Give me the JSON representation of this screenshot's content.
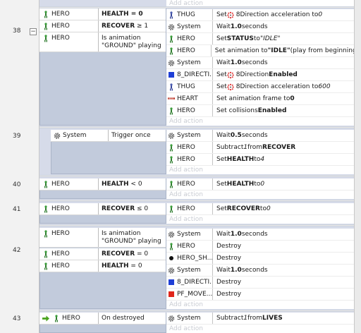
{
  "add_action_label": "Add action",
  "events": [
    {
      "number": "38",
      "collapse": "−",
      "conditions": [
        {
          "object": "HERO",
          "icon": "hero-icon",
          "parts": [
            {
              "t": "HEALTH = 0",
              "b": true
            }
          ]
        },
        {
          "object": "HERO",
          "icon": "hero-icon",
          "parts": [
            {
              "t": "RECOVER",
              "b": true
            },
            {
              "t": " ≥ 1"
            }
          ]
        },
        {
          "object": "HERO",
          "icon": "hero-icon",
          "parts": [
            {
              "t": "Is animation"
            },
            {
              "br": true
            },
            {
              "t": "\"GROUND\" playing"
            }
          ]
        }
      ],
      "actions": [
        {
          "object": "THUG",
          "icon": "thug-icon",
          "parts": [
            {
              "t": "Set "
            },
            {
              "icon": "8direction-icon"
            },
            {
              "t": "8Direction acceleration to "
            },
            {
              "t": "0",
              "i": true
            }
          ]
        },
        {
          "object": "System",
          "icon": "gear-icon",
          "parts": [
            {
              "t": "Wait "
            },
            {
              "t": "1.0",
              "b": true
            },
            {
              "t": " seconds"
            }
          ]
        },
        {
          "object": "HERO",
          "icon": "hero-icon",
          "parts": [
            {
              "t": "Set "
            },
            {
              "t": "STATUS",
              "b": true
            },
            {
              "t": " to "
            },
            {
              "t": "\"IDLE\"",
              "i": true
            }
          ]
        },
        {
          "object": "HERO",
          "icon": "hero-icon",
          "parts": [
            {
              "t": "Set animation to "
            },
            {
              "t": "\"IDLE\"",
              "b": true
            },
            {
              "t": " (play from beginning)"
            }
          ]
        },
        {
          "object": "System",
          "icon": "gear-icon",
          "parts": [
            {
              "t": "Wait "
            },
            {
              "t": "1.0",
              "b": true
            },
            {
              "t": " seconds"
            }
          ]
        },
        {
          "object": "8_DIRECTI...",
          "icon": "blue-square-icon",
          "parts": [
            {
              "t": "Set "
            },
            {
              "icon": "8direction-icon"
            },
            {
              "t": "8Direction "
            },
            {
              "t": "Enabled",
              "b": true
            }
          ]
        },
        {
          "object": "THUG",
          "icon": "thug-icon",
          "parts": [
            {
              "t": "Set "
            },
            {
              "icon": "8direction-icon"
            },
            {
              "t": "8Direction acceleration to "
            },
            {
              "t": "600",
              "i": true
            }
          ]
        },
        {
          "object": "HEART",
          "icon": "heart-strip-icon",
          "parts": [
            {
              "t": "Set animation frame to "
            },
            {
              "t": "0",
              "b": true
            }
          ]
        },
        {
          "object": "HERO",
          "icon": "hero-icon",
          "parts": [
            {
              "t": "Set collisions "
            },
            {
              "t": "Enabled",
              "b": true
            }
          ]
        }
      ]
    },
    {
      "number": "39",
      "conditions": [
        {
          "object": "System",
          "icon": "gear-icon",
          "parts": [
            {
              "t": "Trigger once"
            }
          ]
        }
      ],
      "actions": [
        {
          "object": "System",
          "icon": "gear-icon",
          "parts": [
            {
              "t": "Wait "
            },
            {
              "t": "0.5",
              "b": true
            },
            {
              "t": " seconds"
            }
          ]
        },
        {
          "object": "HERO",
          "icon": "hero-icon",
          "parts": [
            {
              "t": "Subtract "
            },
            {
              "t": "1",
              "i": true
            },
            {
              "t": " from "
            },
            {
              "t": "RECOVER",
              "b": true
            }
          ]
        },
        {
          "object": "HERO",
          "icon": "hero-icon",
          "parts": [
            {
              "t": "Set "
            },
            {
              "t": "HEALTH",
              "b": true
            },
            {
              "t": " to "
            },
            {
              "t": "4",
              "i": true
            }
          ]
        }
      ]
    },
    {
      "number": "40",
      "conditions": [
        {
          "object": "HERO",
          "icon": "hero-icon",
          "parts": [
            {
              "t": "HEALTH",
              "b": true
            },
            {
              "t": " < 0"
            }
          ]
        }
      ],
      "actions": [
        {
          "object": "HERO",
          "icon": "hero-icon",
          "parts": [
            {
              "t": "Set "
            },
            {
              "t": "HEALTH",
              "b": true
            },
            {
              "t": " to "
            },
            {
              "t": "0",
              "i": true
            }
          ]
        }
      ]
    },
    {
      "number": "41",
      "conditions": [
        {
          "object": "HERO",
          "icon": "hero-icon",
          "parts": [
            {
              "t": "RECOVER",
              "b": true
            },
            {
              "t": " ≤ 0"
            }
          ]
        }
      ],
      "actions": [
        {
          "object": "HERO",
          "icon": "hero-icon",
          "parts": [
            {
              "t": "Set "
            },
            {
              "t": "RECOVER",
              "b": true
            },
            {
              "t": " to "
            },
            {
              "t": "0",
              "i": true
            }
          ]
        }
      ]
    },
    {
      "number": "42",
      "conditions": [
        {
          "object": "HERO",
          "icon": "hero-icon",
          "parts": [
            {
              "t": "Is animation"
            },
            {
              "br": true
            },
            {
              "t": "\"GROUND\" playing"
            }
          ]
        },
        {
          "object": "HERO",
          "icon": "hero-icon",
          "parts": [
            {
              "t": "RECOVER",
              "b": true
            },
            {
              "t": " = 0"
            }
          ]
        },
        {
          "object": "HERO",
          "icon": "hero-icon",
          "parts": [
            {
              "t": "HEALTH",
              "b": true
            },
            {
              "t": " = 0"
            }
          ]
        }
      ],
      "actions": [
        {
          "object": "System",
          "icon": "gear-icon",
          "parts": [
            {
              "t": "Wait "
            },
            {
              "t": "1.0",
              "b": true
            },
            {
              "t": " seconds"
            }
          ]
        },
        {
          "object": "HERO",
          "icon": "hero-icon",
          "parts": [
            {
              "t": "Destroy"
            }
          ]
        },
        {
          "object": "HERO_SH...",
          "icon": "black-dot-icon",
          "parts": [
            {
              "t": "Destroy"
            }
          ]
        },
        {
          "object": "System",
          "icon": "gear-icon",
          "parts": [
            {
              "t": "Wait "
            },
            {
              "t": "1.0",
              "b": true
            },
            {
              "t": " seconds"
            }
          ]
        },
        {
          "object": "8_DIRECTI...",
          "icon": "blue-square-icon",
          "parts": [
            {
              "t": "Destroy"
            }
          ]
        },
        {
          "object": "PF_MOVE...",
          "icon": "red-square-icon",
          "parts": [
            {
              "t": "Destroy"
            }
          ]
        }
      ]
    },
    {
      "number": "43",
      "conditions": [
        {
          "object": "HERO",
          "icon": "hero-icon",
          "trigger": "green-arrow-icon",
          "parts": [
            {
              "t": "On destroyed"
            }
          ]
        }
      ],
      "actions": [
        {
          "object": "System",
          "icon": "gear-icon",
          "parts": [
            {
              "t": "Subtract "
            },
            {
              "t": "1",
              "i": true
            },
            {
              "t": " from "
            },
            {
              "t": "LIVES",
              "b": true
            }
          ]
        }
      ]
    }
  ]
}
